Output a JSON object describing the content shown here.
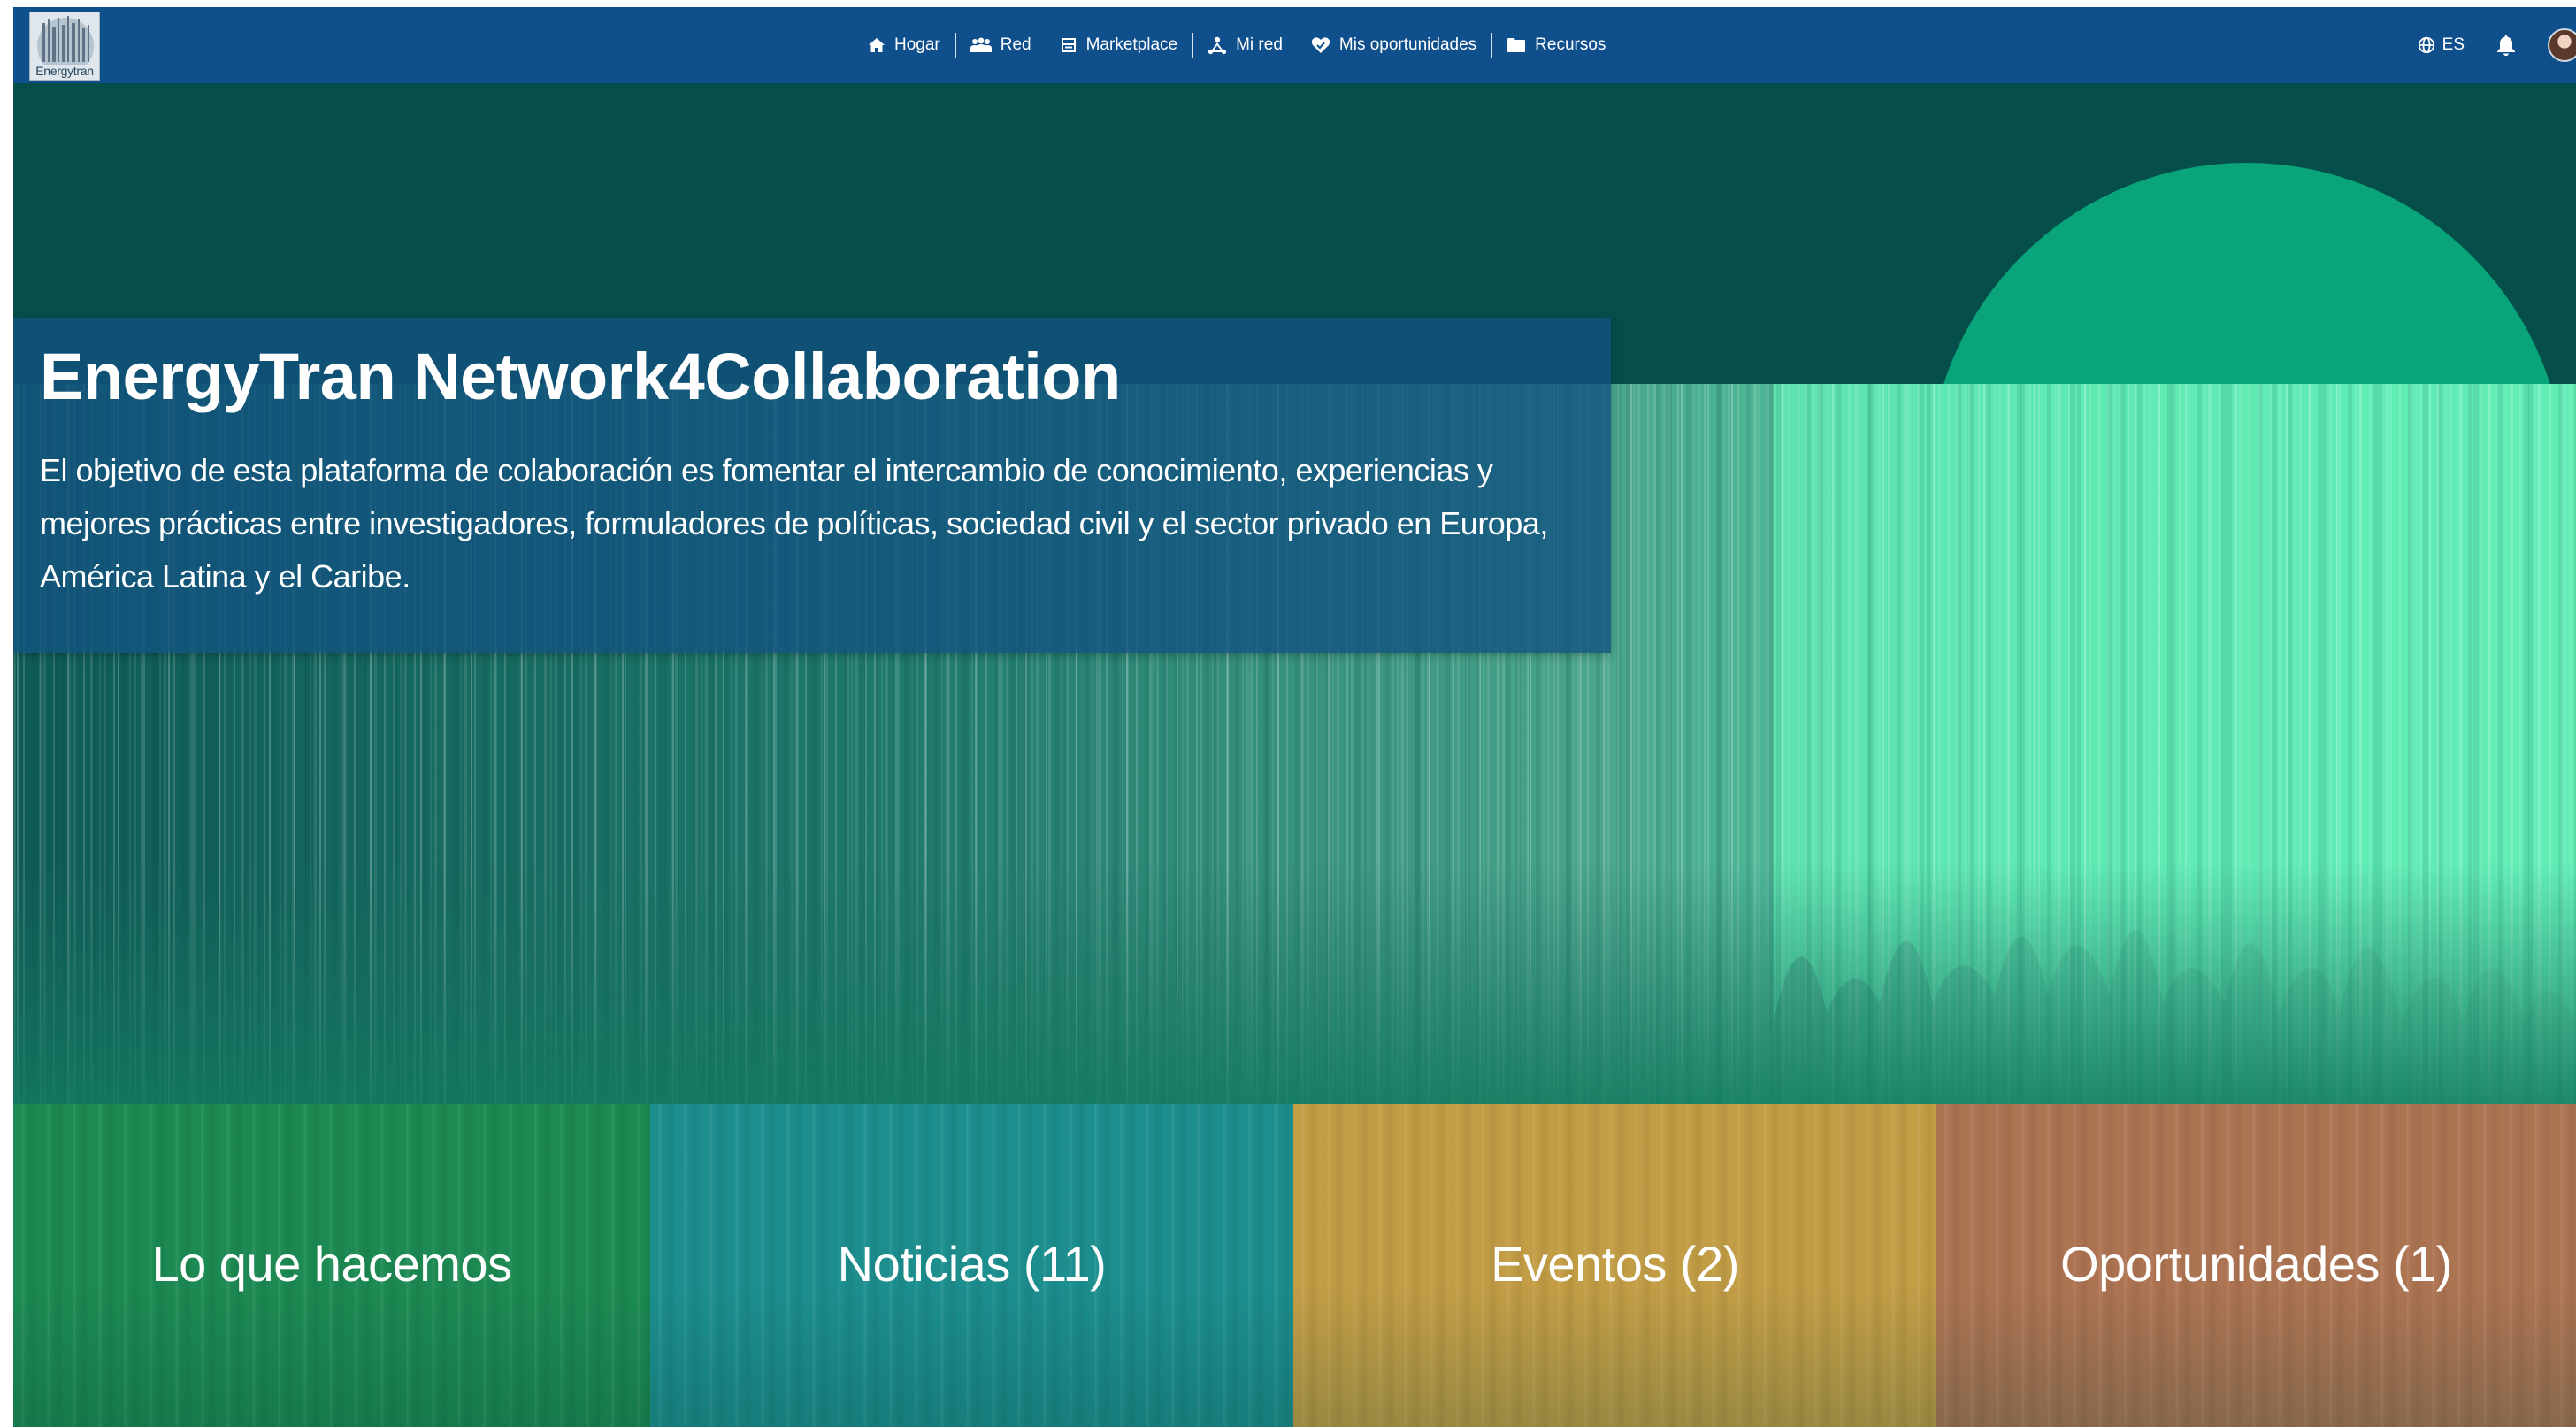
{
  "app": {
    "logo_text": "Energytran"
  },
  "nav": {
    "items": [
      {
        "label": "Hogar",
        "icon": "home-icon"
      },
      {
        "label": "Red",
        "icon": "network-icon"
      },
      {
        "label": "Marketplace",
        "icon": "marketplace-icon"
      },
      {
        "label": "Mi red",
        "icon": "my-network-icon"
      },
      {
        "label": "Mis oportunidades",
        "icon": "opportunities-icon"
      },
      {
        "label": "Recursos",
        "icon": "folder-icon"
      }
    ],
    "language": "ES",
    "right_icons": [
      "globe-icon",
      "bell-icon",
      "avatar"
    ]
  },
  "hero": {
    "title": "EnergyTran Network4Collaboration",
    "description": "El objetivo de esta plataforma de colaboración es fomentar el intercambio de conocimiento, experiencias y mejores prácticas entre investigadores, formuladores de políticas, sociedad civil y el sector privado en Europa, América Latina y el Caribe."
  },
  "tiles": [
    {
      "label": "Lo que hacemos",
      "color": "#1c8a52"
    },
    {
      "label": "Noticias (11)",
      "color": "#1c8e8e"
    },
    {
      "label": "Eventos (2)",
      "color": "#c29d45"
    },
    {
      "label": "Oportunidades (1)",
      "color": "#ad7452"
    }
  ],
  "colors": {
    "navbar": "#0f4f8c",
    "hero_dark": "#054e4a",
    "hero_accent": "#3ee6a8",
    "intro_box": "#115280"
  }
}
